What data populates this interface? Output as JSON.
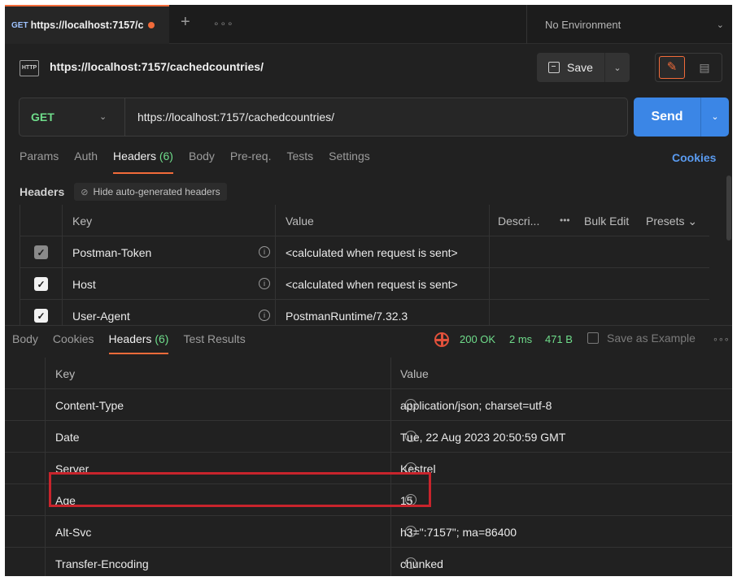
{
  "tab": {
    "method": "GET",
    "url": "https://localhost:7157/c",
    "new_tab": "+",
    "more": "∘∘∘"
  },
  "environment": {
    "label": "No Environment"
  },
  "request": {
    "icon_text": "HTTP",
    "title": "https://localhost:7157/cachedcountries/",
    "save_label": "Save",
    "method": "GET",
    "url": "https://localhost:7157/cachedcountries/",
    "send_label": "Send"
  },
  "request_tabs": [
    {
      "label": "Params",
      "count": ""
    },
    {
      "label": "Auth",
      "count": ""
    },
    {
      "label": "Headers",
      "count": "(6)"
    },
    {
      "label": "Body",
      "count": ""
    },
    {
      "label": "Pre-req.",
      "count": ""
    },
    {
      "label": "Tests",
      "count": ""
    },
    {
      "label": "Settings",
      "count": ""
    }
  ],
  "cookies_link": "Cookies",
  "headers_section": {
    "title": "Headers",
    "hide_auto": "Hide auto-generated headers"
  },
  "request_headers": {
    "columns": {
      "key": "Key",
      "value": "Value",
      "description": "Descri...",
      "more": "•••",
      "bulk_edit": "Bulk Edit",
      "presets": "Presets ⌄"
    },
    "rows": [
      {
        "key": "Postman-Token",
        "value": "<calculated when request is sent>",
        "checked_dim": true
      },
      {
        "key": "Host",
        "value": "<calculated when request is sent>",
        "checked_dim": false
      },
      {
        "key": "User-Agent",
        "value": "PostmanRuntime/7.32.3",
        "checked_dim": false
      }
    ]
  },
  "response_tabs": [
    {
      "label": "Body",
      "count": ""
    },
    {
      "label": "Cookies",
      "count": ""
    },
    {
      "label": "Headers",
      "count": "(6)"
    },
    {
      "label": "Test Results",
      "count": ""
    }
  ],
  "response_status": {
    "status": "200 OK",
    "time": "2 ms",
    "size": "471 B",
    "save_example": "Save as Example",
    "more": "∘∘∘"
  },
  "response_headers": {
    "columns": {
      "key": "Key",
      "value": "Value"
    },
    "rows": [
      {
        "key": "Content-Type",
        "value": "application/json; charset=utf-8"
      },
      {
        "key": "Date",
        "value": "Tue, 22 Aug 2023 20:50:59 GMT"
      },
      {
        "key": "Server",
        "value": "Kestrel"
      },
      {
        "key": "Age",
        "value": "15"
      },
      {
        "key": "Alt-Svc",
        "value": "h3=\":7157\"; ma=86400"
      },
      {
        "key": "Transfer-Encoding",
        "value": "chunked"
      }
    ]
  },
  "colors": {
    "accent": "#f26b3a",
    "send": "#3b86e6",
    "success": "#6fdd8b",
    "highlight": "#c8242c"
  }
}
